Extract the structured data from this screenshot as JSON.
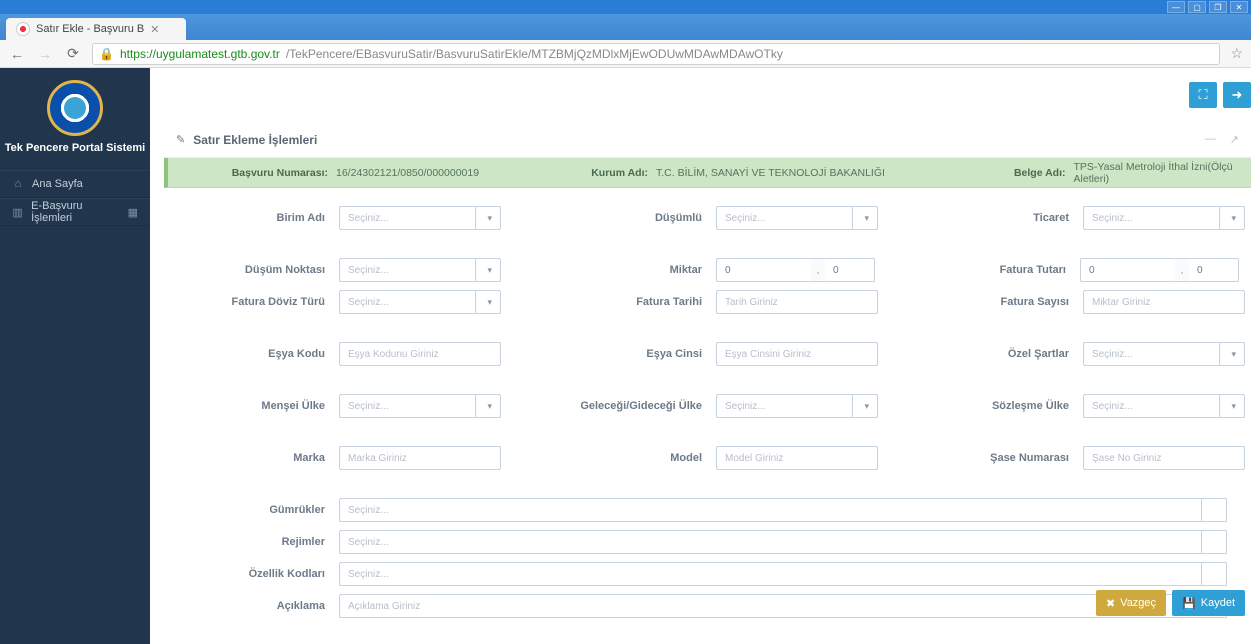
{
  "browser": {
    "tab_title": "Satır Ekle - Başvuru B",
    "url_host": "https://uygulamatest.gtb.gov.tr",
    "url_path": "/TekPencere/EBasvuruSatir/BasvuruSatirEkle/MTZBMjQzMDlxMjEwODUwMDAwMDAwOTky"
  },
  "portal": {
    "title": "Tek Pencere Portal Sistemi",
    "menu": {
      "home": "Ana Sayfa",
      "eapp": "E-Başvuru İşlemleri"
    }
  },
  "panel": {
    "title": "Satır Ekleme İşlemleri"
  },
  "header": {
    "basvuru_label": "Başvuru Numarası:",
    "basvuru_val": "16/24302121/0850/000000019",
    "kurum_label": "Kurum Adı:",
    "kurum_val": "T.C. BİLİM, SANAYİ VE TEKNOLOJİ BAKANLIĞI",
    "belge_label": "Belge Adı:",
    "belge_val": "TPS-Yasal Metroloji İthal İzni(Ölçü Aletleri)"
  },
  "labels": {
    "birim_adi": "Birim Adı",
    "dusumlu": "Düşümlü",
    "ticaret": "Ticaret",
    "dusum_noktasi": "Düşüm Noktası",
    "miktar": "Miktar",
    "fatura_tutari": "Fatura Tutarı",
    "fatura_doviz": "Fatura Döviz Türü",
    "fatura_tarihi": "Fatura Tarihi",
    "fatura_sayisi": "Fatura Sayısı",
    "esya_kodu": "Eşya Kodu",
    "esya_cinsi": "Eşya Cinsi",
    "ozel_sartlar": "Özel Şartlar",
    "mensei_ulke": "Menşei Ülke",
    "gelecegi_ulke": "Geleceği/Gideceği Ülke",
    "sozlesme_ulke": "Sözleşme Ülke",
    "marka": "Marka",
    "model": "Model",
    "sase_no": "Şase Numarası",
    "gumrukler": "Gümrükler",
    "rejimler": "Rejimler",
    "ozellik_kodlari": "Özellik Kodları",
    "aciklama": "Açıklama"
  },
  "placeholders": {
    "sec": "Seçiniz...",
    "tarih": "Tarih Giriniz",
    "miktar": "Miktar Giriniz",
    "esya_kodu": "Eşya Kodunu Giriniz",
    "esya_cinsi": "Eşya Cinsini Giriniz",
    "marka": "Marka Giriniz",
    "model": "Model Giriniz",
    "sase": "Şase No Giriniz",
    "aciklama": "Açıklama Giriniz"
  },
  "values": {
    "miktar_int": "0",
    "miktar_dec": "0",
    "fatura_int": "0",
    "fatura_dec": "0",
    "sep": ","
  },
  "buttons": {
    "vazgec": "Vazgeç",
    "kaydet": "Kaydet"
  }
}
